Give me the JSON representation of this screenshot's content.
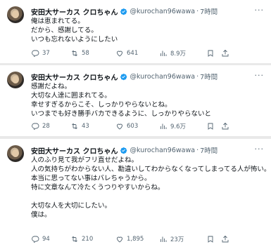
{
  "tweets": [
    {
      "name": "安田大サーカス クロちゃん",
      "handle": "@kurochan96wawa",
      "dot": "·",
      "time": "7時間",
      "text": "俺は恵まれてる。\nだから、感謝してる。\nいつも忘れないようにしたい",
      "replies": "37",
      "retweets": "58",
      "likes": "641",
      "views": "8.9万"
    },
    {
      "name": "安田大サーカス クロちゃん",
      "handle": "@kurochan96wawa",
      "dot": "·",
      "time": "7時間",
      "text": "感謝だよね。\n大切な人達に囲まれてる。\n幸せすぎるからこそ、しっかりやらないとね。\nいつまでも好き勝手バカできるように、しっかりやらないと",
      "replies": "28",
      "retweets": "43",
      "likes": "603",
      "views": "9.6万"
    },
    {
      "name": "安田大サーカス クロちゃん",
      "handle": "@kurochan96wawa",
      "dot": "·",
      "time": "7時間",
      "text": "人のふり見て我がフリ直せだよね。\n人の気持ちがわからない人、勘違いしてわからなくなってしまってる人が怖い。\n本当に思ってない事はバレちゃうから。\n特に文章なんて冷たくうつりやすいからね。\n\n大切な人を大切にしたい。\n僕は。",
      "replies": "94",
      "retweets": "210",
      "likes": "1,895",
      "views": "23万"
    }
  ],
  "icons": {
    "verified": "verified-badge-icon",
    "more": "more-options-icon",
    "reply": "reply-icon",
    "retweet": "retweet-icon",
    "like": "like-icon",
    "views": "views-icon",
    "bookmark": "bookmark-icon",
    "share": "share-icon"
  },
  "colors": {
    "verified": "#1d9bf0",
    "muted": "#536471",
    "text": "#0f1419",
    "background": "#e9e9e9"
  }
}
